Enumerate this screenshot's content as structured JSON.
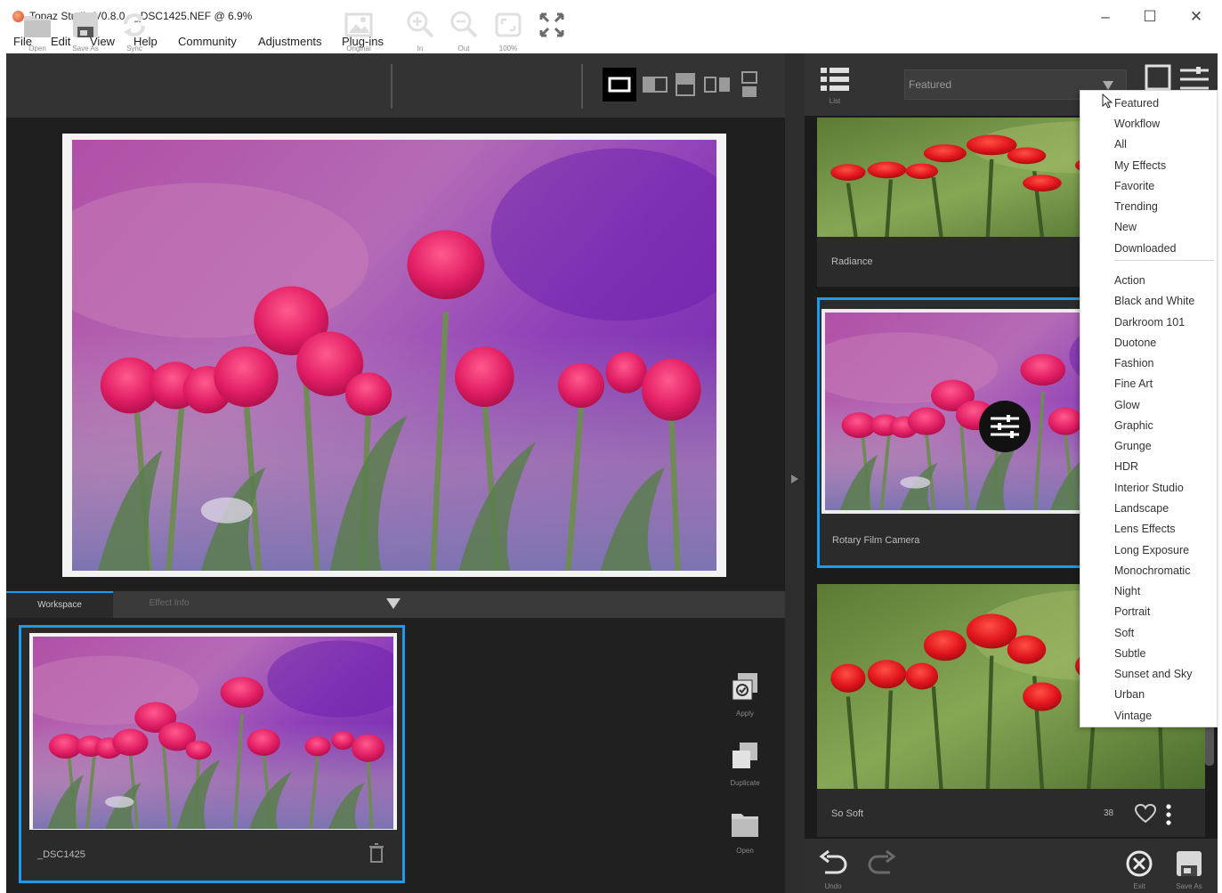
{
  "window": {
    "title": "Topaz Studio V0.8.0 - _DSC1425.NEF @ 6.9%",
    "minimize": "–",
    "maximize": "☐",
    "close": "✕"
  },
  "menu": [
    "File",
    "Edit",
    "View",
    "Help",
    "Community",
    "Adjustments",
    "Plug-ins"
  ],
  "toolbar": {
    "open": "Open",
    "save_as": "Save As",
    "sync": "Sync",
    "original": "Original",
    "zoom_in": "In",
    "zoom_out": "Out",
    "zoom_100": "100%"
  },
  "workspace": {
    "tabs": [
      "Workspace",
      "Effect Info"
    ],
    "thumbnail_name": "_DSC1425",
    "apply": "Apply",
    "duplicate": "Duplicate",
    "open": "Open"
  },
  "effects_panel": {
    "list_label": "List",
    "category_value": "Featured",
    "cards": [
      {
        "name": "Radiance"
      },
      {
        "name": "Rotary Film Camera"
      },
      {
        "name": "So Soft",
        "likes": "38"
      }
    ],
    "undo": "Undo",
    "exit": "Exit",
    "save_as": "Save As"
  },
  "category_dropdown": {
    "group1": [
      "Featured",
      "Workflow",
      "All",
      "My Effects",
      "Favorite",
      "Trending",
      "New",
      "Downloaded"
    ],
    "group2": [
      "Action",
      "Black and White",
      "Darkroom 101",
      "Duotone",
      "Fashion",
      "Fine Art",
      "Glow",
      "Graphic",
      "Grunge",
      "HDR",
      "Interior Studio",
      "Landscape",
      "Lens Effects",
      "Long Exposure",
      "Monochromatic",
      "Night",
      "Portrait",
      "Soft",
      "Subtle",
      "Sunset and Sky",
      "Urban",
      "Vintage"
    ]
  },
  "colors": {
    "accent": "#1e9be8",
    "panel_dark": "#1f1f1f",
    "toolbar": "#333333"
  }
}
